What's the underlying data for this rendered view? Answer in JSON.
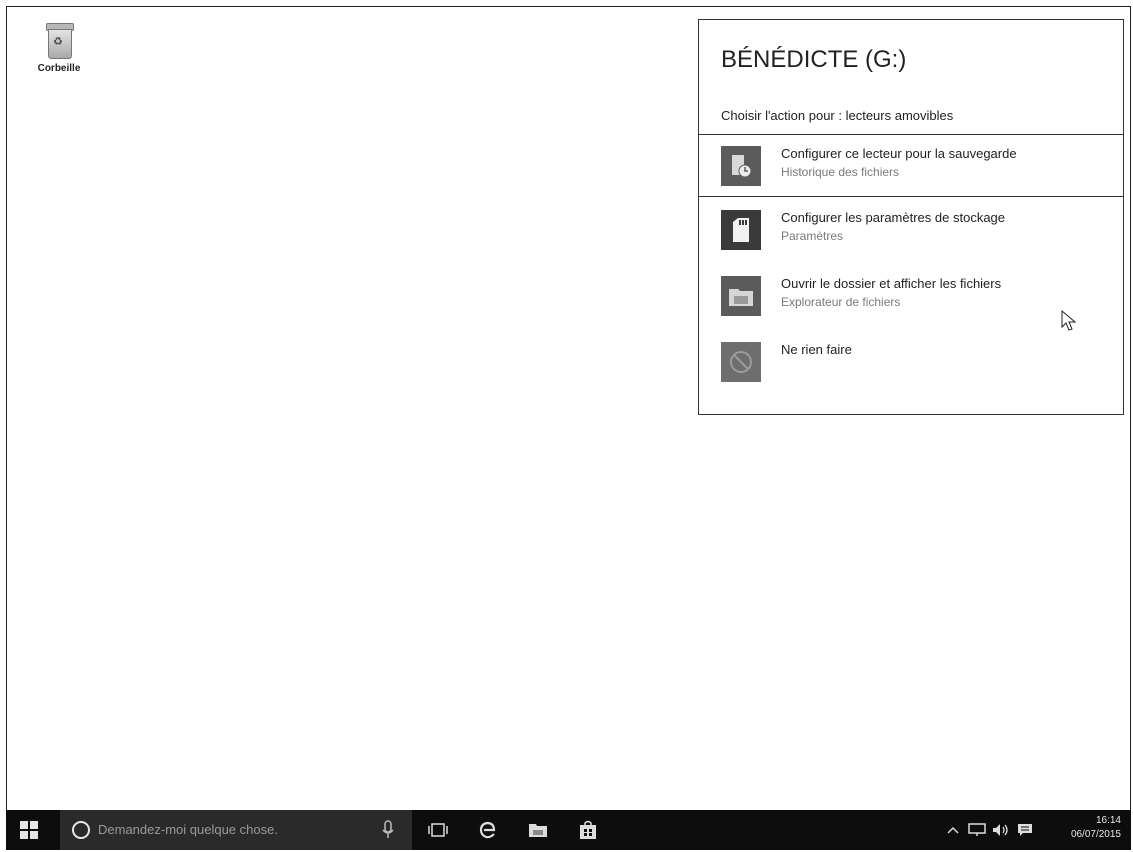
{
  "desktop": {
    "recycle_bin_label": "Corbeille"
  },
  "autoplay": {
    "title": "BÉNÉDICTE (G:)",
    "subtitle": "Choisir l'action pour : lecteurs amovibles",
    "options": [
      {
        "title": "Configurer ce lecteur pour la sauvegarde",
        "description": "Historique des fichiers",
        "icon": "file-history-icon"
      },
      {
        "title": "Configurer les paramètres de stockage",
        "description": "Paramètres",
        "icon": "sd-card-icon"
      },
      {
        "title": "Ouvrir le dossier et afficher les fichiers",
        "description": "Explorateur de fichiers",
        "icon": "folder-icon"
      },
      {
        "title": "Ne rien faire",
        "description": "",
        "icon": "no-action-icon"
      }
    ]
  },
  "taskbar": {
    "search_placeholder": "Demandez-moi quelque chose.",
    "time": "16:14",
    "date": "06/07/2015"
  }
}
